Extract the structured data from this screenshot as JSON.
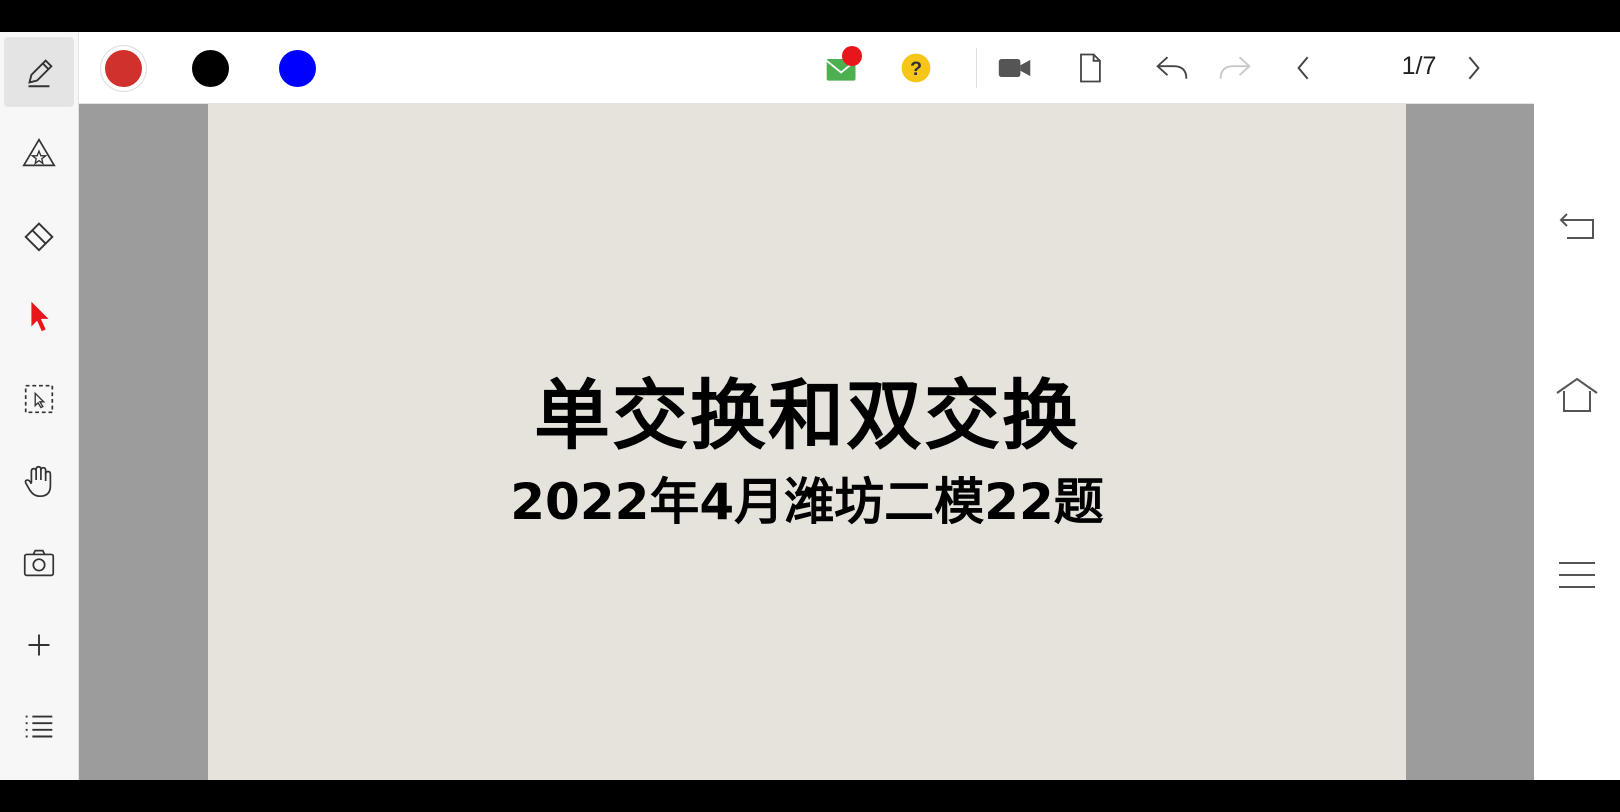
{
  "sidebar": {
    "tools": [
      {
        "name": "pen-tool",
        "icon": "pencil-icon",
        "active": true
      },
      {
        "name": "shape-tool",
        "icon": "shape-magic-icon",
        "active": false
      },
      {
        "name": "eraser-tool",
        "icon": "eraser-icon",
        "active": false
      },
      {
        "name": "pointer-tool",
        "icon": "red-cursor-icon",
        "active": false
      },
      {
        "name": "select-tool",
        "icon": "dashed-select-icon",
        "active": false
      },
      {
        "name": "pan-tool",
        "icon": "hand-icon",
        "active": false
      },
      {
        "name": "screenshot-tool",
        "icon": "camera-icon",
        "active": false
      },
      {
        "name": "add-tool",
        "icon": "plus-icon",
        "active": false
      },
      {
        "name": "list-tool",
        "icon": "list-icon",
        "active": false
      }
    ]
  },
  "toolbar": {
    "colors": [
      {
        "name": "red",
        "hex": "#d0312d",
        "selected": true
      },
      {
        "name": "black",
        "hex": "#000000",
        "selected": false
      },
      {
        "name": "blue",
        "hex": "#0000ff",
        "selected": false
      }
    ],
    "icons": [
      "mail-icon",
      "help-icon",
      "video-icon",
      "page-icon",
      "undo-icon",
      "redo-icon",
      "prev-page-icon",
      "next-page-icon"
    ],
    "page_counter": "1/7"
  },
  "slide": {
    "title": "单交换和双交换",
    "subtitle": "2022年4月潍坊二模22题"
  },
  "navigation": {
    "buttons": [
      "back-icon",
      "home-icon",
      "menu-icon"
    ]
  },
  "colors": {
    "slide_bg": "#e6e3dc",
    "canvas_bg": "#9c9c9c",
    "accent_red": "#e8151b",
    "help_yellow": "#f5c518",
    "mail_green": "#4caf50"
  }
}
